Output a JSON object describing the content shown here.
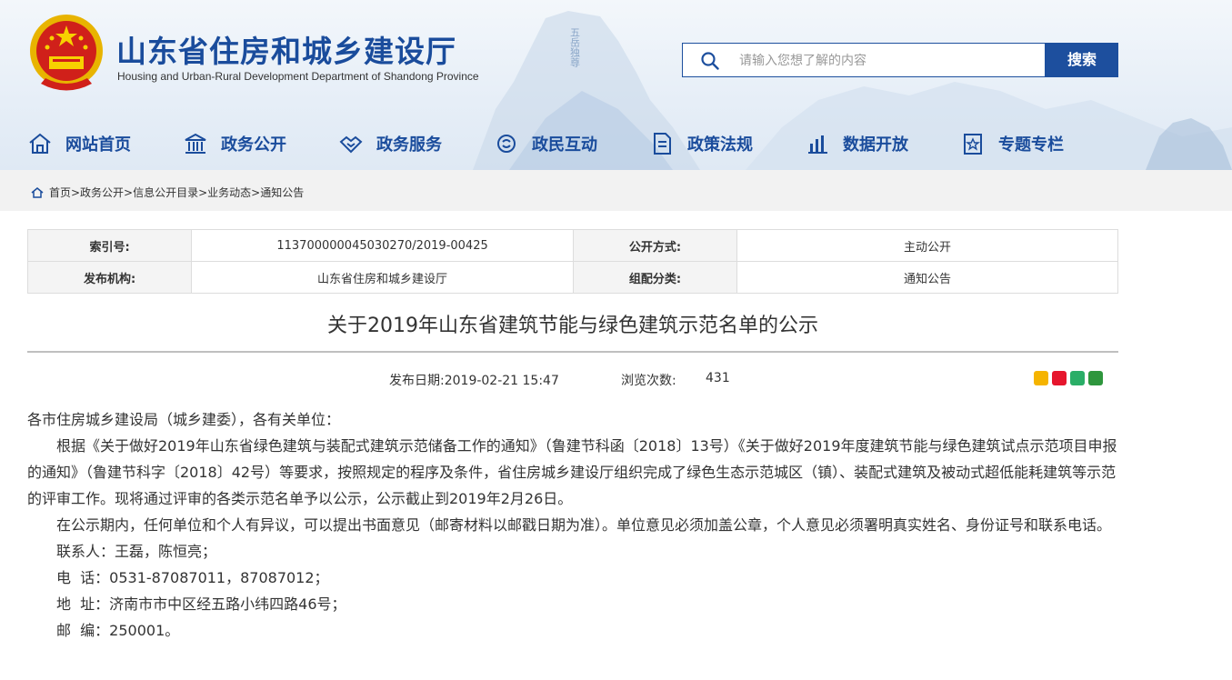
{
  "header": {
    "title": "山东省住房和城乡建设厅",
    "subtitle": "Housing and Urban-Rural Development Department of Shandong Province",
    "search_placeholder": "请输入您想了解的内容",
    "search_button": "搜索",
    "colors": {
      "brand_blue": "#1a4c9c",
      "button_blue": "#1d4f9e"
    }
  },
  "nav": [
    {
      "label": "网站首页",
      "icon": "home-icon"
    },
    {
      "label": "政务公开",
      "icon": "government-building-icon"
    },
    {
      "label": "政务服务",
      "icon": "handshake-icon"
    },
    {
      "label": "政民互动",
      "icon": "interaction-icon"
    },
    {
      "label": "政策法规",
      "icon": "document-icon"
    },
    {
      "label": "数据开放",
      "icon": "bar-chart-icon"
    },
    {
      "label": "专题专栏",
      "icon": "star-document-icon"
    }
  ],
  "breadcrumb": "首页>政务公开>信息公开目录>业务动态>通知公告",
  "meta": {
    "index_label": "索引号:",
    "index_value": "113700000045030270/2019-00425",
    "public_method_label": "公开方式:",
    "public_method_value": "主动公开",
    "issuer_label": "发布机构:",
    "issuer_value": "山东省住房和城乡建设厅",
    "category_label": "组配分类:",
    "category_value": "通知公告"
  },
  "article": {
    "title": "关于2019年山东省建筑节能与绿色建筑示范名单的公示",
    "publish_date": "发布日期:2019-02-21 15:47",
    "views_label": "浏览次数:",
    "views_value": "431",
    "share_icons": [
      "qzone-icon",
      "weibo-icon",
      "wechat-icon",
      "douban-icon"
    ],
    "paragraphs": [
      "各市住房城乡建设局（城乡建委），各有关单位：",
      "根据《关于做好2019年山东省绿色建筑与装配式建筑示范储备工作的通知》（鲁建节科函〔2018〕13号）《关于做好2019年度建筑节能与绿色建筑试点示范项目申报的通知》（鲁建节科字〔2018〕42号）等要求，按照规定的程序及条件，省住房城乡建设厅组织完成了绿色生态示范城区（镇）、装配式建筑及被动式超低能耗建筑等示范的评审工作。现将通过评审的各类示范名单予以公示，公示截止到2019年2月26日。",
      "在公示期内，任何单位和个人有异议，可以提出书面意见（邮寄材料以邮戳日期为准）。单位意见必须加盖公章，个人意见必须署明真实姓名、身份证号和联系电话。",
      "联系人：王磊，陈恒亮；",
      "电  话：0531-87087011，87087012；",
      "地  址：济南市市中区经五路小纬四路46号；",
      "邮  编：250001。"
    ]
  }
}
